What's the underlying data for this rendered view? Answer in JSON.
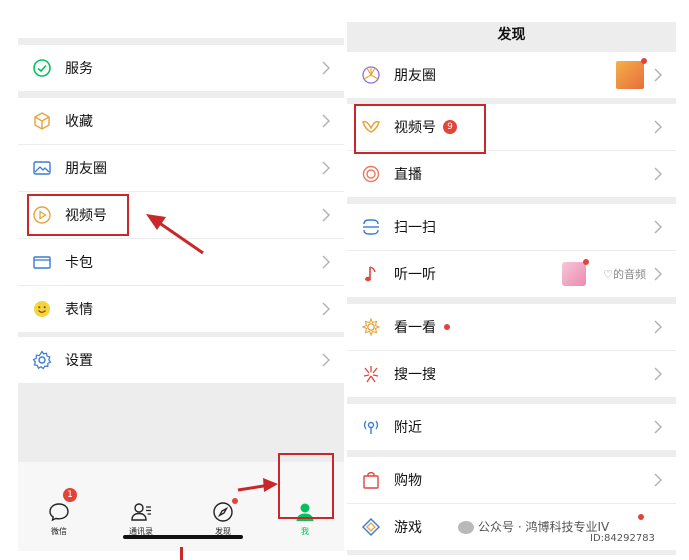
{
  "left": {
    "items": [
      {
        "label": "服务",
        "icon": "service-icon"
      },
      {
        "label": "收藏",
        "icon": "favorites-icon"
      },
      {
        "label": "朋友圈",
        "icon": "moments-icon"
      },
      {
        "label": "视频号",
        "icon": "channels-icon"
      },
      {
        "label": "卡包",
        "icon": "card-wallet-icon"
      },
      {
        "label": "表情",
        "icon": "sticker-icon"
      },
      {
        "label": "设置",
        "icon": "settings-icon"
      }
    ],
    "tabs": [
      {
        "label": "微信",
        "icon": "chat-icon",
        "badge": "1"
      },
      {
        "label": "通讯录",
        "icon": "contacts-icon"
      },
      {
        "label": "发现",
        "icon": "discover-icon"
      },
      {
        "label": "我",
        "icon": "me-icon"
      }
    ]
  },
  "right": {
    "title": "发现",
    "items": [
      {
        "label": "朋友圈",
        "icon": "moments-icon"
      },
      {
        "label": "视频号",
        "icon": "channels-icon",
        "badge": "9"
      },
      {
        "label": "直播",
        "icon": "live-icon"
      },
      {
        "label": "扫一扫",
        "icon": "scan-icon"
      },
      {
        "label": "听一听",
        "icon": "listen-icon",
        "extra": "♡的音频"
      },
      {
        "label": "看一看",
        "icon": "top-stories-icon"
      },
      {
        "label": "搜一搜",
        "icon": "search-icon"
      },
      {
        "label": "附近",
        "icon": "nearby-icon"
      },
      {
        "label": "购物",
        "icon": "shopping-icon"
      },
      {
        "label": "游戏",
        "icon": "games-icon"
      }
    ]
  },
  "watermark": {
    "line1": "公众号 · 鸿博科技专业IV",
    "line2": "ID:84292783"
  },
  "colors": {
    "wechat_green": "#07c160",
    "highlight_red": "#c8282a",
    "badge_red": "#e2443a",
    "background": "#ededed"
  }
}
